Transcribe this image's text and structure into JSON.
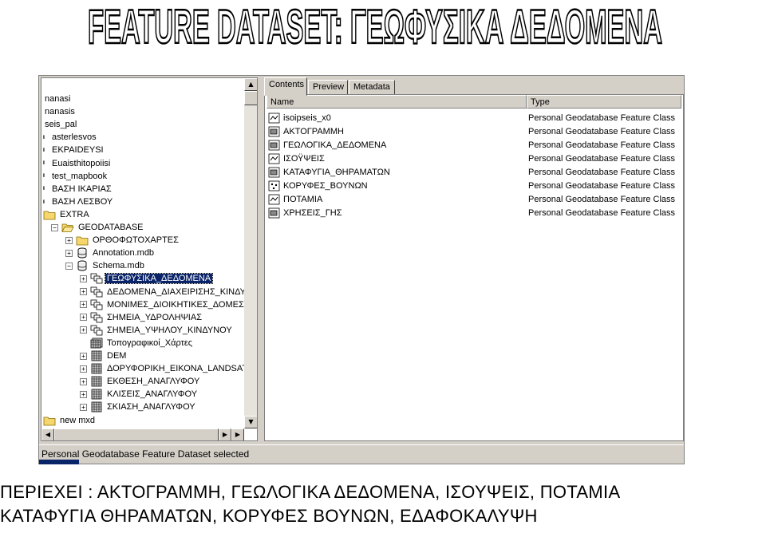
{
  "slide": {
    "title": "FEATURE DATASET: ΓΕΩΦΥΣΙΚΑ ΔΕΔΟΜΕΝΑ",
    "caption_line1": "ΠΕΡΙΕΧΕΙ : ΑΚΤΟΓΡΑΜΜΗ, ΓΕΩΛΟΓΙΚΑ ΔΕΔΟΜΕΝΑ, ΙΣΟΥΨΕΙΣ, ΠΟΤΑΜΙΑ",
    "caption_line2": "ΚΑΤΑΦΥΓΙΑ ΘΗΡΑΜΑΤΩΝ, ΚΟΡΥΦΕΣ ΒΟΥΝΩΝ, ΕΔΑΦΟΚΑΛΥΨΗ"
  },
  "tree": {
    "items": [
      {
        "label": "nanasi",
        "icon": "none",
        "expander": "none",
        "indent": 0
      },
      {
        "label": "nanasis",
        "icon": "none",
        "expander": "none",
        "indent": 0
      },
      {
        "label": "seis_pal",
        "icon": "none",
        "expander": "none",
        "indent": 0
      },
      {
        "label": "asterlesvos",
        "icon": "file-icon",
        "expander": "none",
        "indent": 0
      },
      {
        "label": "EKPAIDEYSI",
        "icon": "file-icon",
        "expander": "none",
        "indent": 0
      },
      {
        "label": "Euaisthitopoiisi",
        "icon": "file-icon",
        "expander": "none",
        "indent": 0
      },
      {
        "label": "test_mapbook",
        "icon": "file-icon",
        "expander": "none",
        "indent": 0
      },
      {
        "label": "ΒΑΣΗ ΙΚΑΡΙΑΣ",
        "icon": "file-icon",
        "expander": "none",
        "indent": 0
      },
      {
        "label": "ΒΑΣΗ ΛΕΣΒΟΥ",
        "icon": "file-icon",
        "expander": "none",
        "indent": 0
      },
      {
        "label": "EXTRA",
        "icon": "folder-icon",
        "expander": "none",
        "indent": 0
      },
      {
        "label": "GEODATABASE",
        "icon": "folder-open-icon",
        "expander": "minus",
        "indent": 0
      },
      {
        "label": "ΟΡΘΟΦΩΤΟΧΑΡΤΕΣ",
        "icon": "folder-icon",
        "expander": "plus",
        "indent": 1
      },
      {
        "label": "Annotation.mdb",
        "icon": "database-icon",
        "expander": "plus",
        "indent": 1
      },
      {
        "label": "Schema.mdb",
        "icon": "database-icon",
        "expander": "minus",
        "indent": 1
      },
      {
        "label": "ΓΕΩΦΥΣΙΚΑ_ΔΕΔΟΜΕΝΑ",
        "icon": "feature-dataset-icon",
        "expander": "plus",
        "indent": 2,
        "selected": true
      },
      {
        "label": "ΔΕΔΟΜΕΝΑ_ΔΙΑΧΕΙΡΙΣΗΣ_ΚΙΝΔΥΝΩΝ",
        "icon": "feature-dataset-icon",
        "expander": "plus",
        "indent": 2
      },
      {
        "label": "ΜΟΝΙΜΕΣ_ΔΙΟΙΚΗΤΙΚΕΣ_ΔΟΜΕΣ",
        "icon": "feature-dataset-icon",
        "expander": "plus",
        "indent": 2
      },
      {
        "label": "ΣΗΜΕΙΑ_ΥΔΡΟΛΗΨΙΑΣ",
        "icon": "feature-dataset-icon",
        "expander": "plus",
        "indent": 2
      },
      {
        "label": "ΣΗΜΕΙΑ_ΥΨΗΛΟΥ_ΚΙΝΔΥΝΟΥ",
        "icon": "feature-dataset-icon",
        "expander": "plus",
        "indent": 2
      },
      {
        "label": "Τοπογραφικοί_Χάρτες",
        "icon": "raster-catalog-icon",
        "expander": "none",
        "indent": 2
      },
      {
        "label": "DEM",
        "icon": "raster-icon",
        "expander": "plus",
        "indent": 2
      },
      {
        "label": "ΔΟΡΥΦΟΡΙΚΗ_ΕΙΚΟΝΑ_LANDSAT",
        "icon": "raster-icon",
        "expander": "plus",
        "indent": 2
      },
      {
        "label": "ΕΚΘΕΣΗ_ΑΝΑΓΛΥΦΟΥ",
        "icon": "raster-icon",
        "expander": "plus",
        "indent": 2
      },
      {
        "label": "ΚΛΙΣΕΙΣ_ΑΝΑΓΛΥΦΟΥ",
        "icon": "raster-icon",
        "expander": "plus",
        "indent": 2
      },
      {
        "label": "ΣΚΙΑΣΗ_ΑΝΑΓΛΥΦΟΥ",
        "icon": "raster-icon",
        "expander": "plus",
        "indent": 2
      },
      {
        "label": "new mxd",
        "icon": "folder-icon",
        "expander": "none",
        "indent": 0
      }
    ]
  },
  "tabs": [
    "Contents",
    "Preview",
    "Metadata"
  ],
  "list": {
    "columns": {
      "name": "Name",
      "type": "Type"
    },
    "rows": [
      {
        "name": "isoipseis_x0",
        "type": "Personal Geodatabase Feature Class",
        "icon": "line-feature-icon"
      },
      {
        "name": "ΑΚΤΟΓΡΑΜΜΗ",
        "type": "Personal Geodatabase Feature Class",
        "icon": "polygon-feature-icon"
      },
      {
        "name": "ΓΕΩΛΟΓΙΚΑ_ΔΕΔΟΜΕΝΑ",
        "type": "Personal Geodatabase Feature Class",
        "icon": "polygon-feature-icon"
      },
      {
        "name": "ΙΣΟΫΨΕΙΣ",
        "type": "Personal Geodatabase Feature Class",
        "icon": "line-feature-icon"
      },
      {
        "name": "ΚΑΤΑΦΥΓΙΑ_ΘΗΡΑΜΑΤΩΝ",
        "type": "Personal Geodatabase Feature Class",
        "icon": "polygon-feature-icon"
      },
      {
        "name": "ΚΟΡΥΦΕΣ_ΒΟΥΝΩΝ",
        "type": "Personal Geodatabase Feature Class",
        "icon": "point-feature-icon"
      },
      {
        "name": "ΠΟΤΑΜΙΑ",
        "type": "Personal Geodatabase Feature Class",
        "icon": "line-feature-icon"
      },
      {
        "name": "ΧΡΗΣΕΙΣ_ΓΗΣ",
        "type": "Personal Geodatabase Feature Class",
        "icon": "polygon-feature-icon"
      }
    ]
  },
  "status": {
    "text": "Personal Geodatabase Feature Dataset selected"
  },
  "colors": {
    "selection": "#0a246a",
    "chrome": "#d4d0c8",
    "folder": "#f5d76e"
  }
}
